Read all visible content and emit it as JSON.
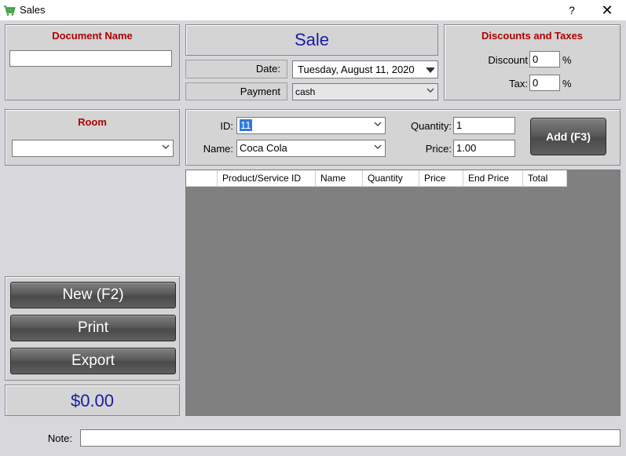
{
  "window": {
    "title": "Sales",
    "help": "?",
    "close": "✕"
  },
  "document": {
    "heading": "Document Name",
    "value": ""
  },
  "sale": {
    "title": "Sale"
  },
  "date": {
    "label": "Date:",
    "value": "Tuesday, August 11, 2020"
  },
  "payment": {
    "label": "Payment",
    "value": "cash"
  },
  "discounts": {
    "heading": "Discounts and Taxes",
    "discount_label": "Discount",
    "discount_value": "0",
    "discount_unit": "%",
    "tax_label": "Tax:",
    "tax_value": "0",
    "tax_unit": "%"
  },
  "room": {
    "heading": "Room",
    "value": ""
  },
  "product": {
    "id_label": "ID:",
    "id_value": "11",
    "name_label": "Name:",
    "name_value": "Coca Cola",
    "quantity_label": "Quantity:",
    "quantity_value": "1",
    "price_label": "Price:",
    "price_value": "1.00",
    "add_button": "Add (F3)"
  },
  "grid": {
    "columns": [
      "",
      "Product/Service ID",
      "Name",
      "Quantity",
      "Price",
      "End Price",
      "Total"
    ]
  },
  "actions": {
    "new": "New (F2)",
    "print": "Print",
    "export": "Export"
  },
  "total": {
    "value": "$0.00"
  },
  "note": {
    "label": "Note:",
    "value": ""
  },
  "colors": {
    "accent_blue": "#1a1aa8",
    "heading_red": "#b00000",
    "grid_bg": "#808080"
  }
}
